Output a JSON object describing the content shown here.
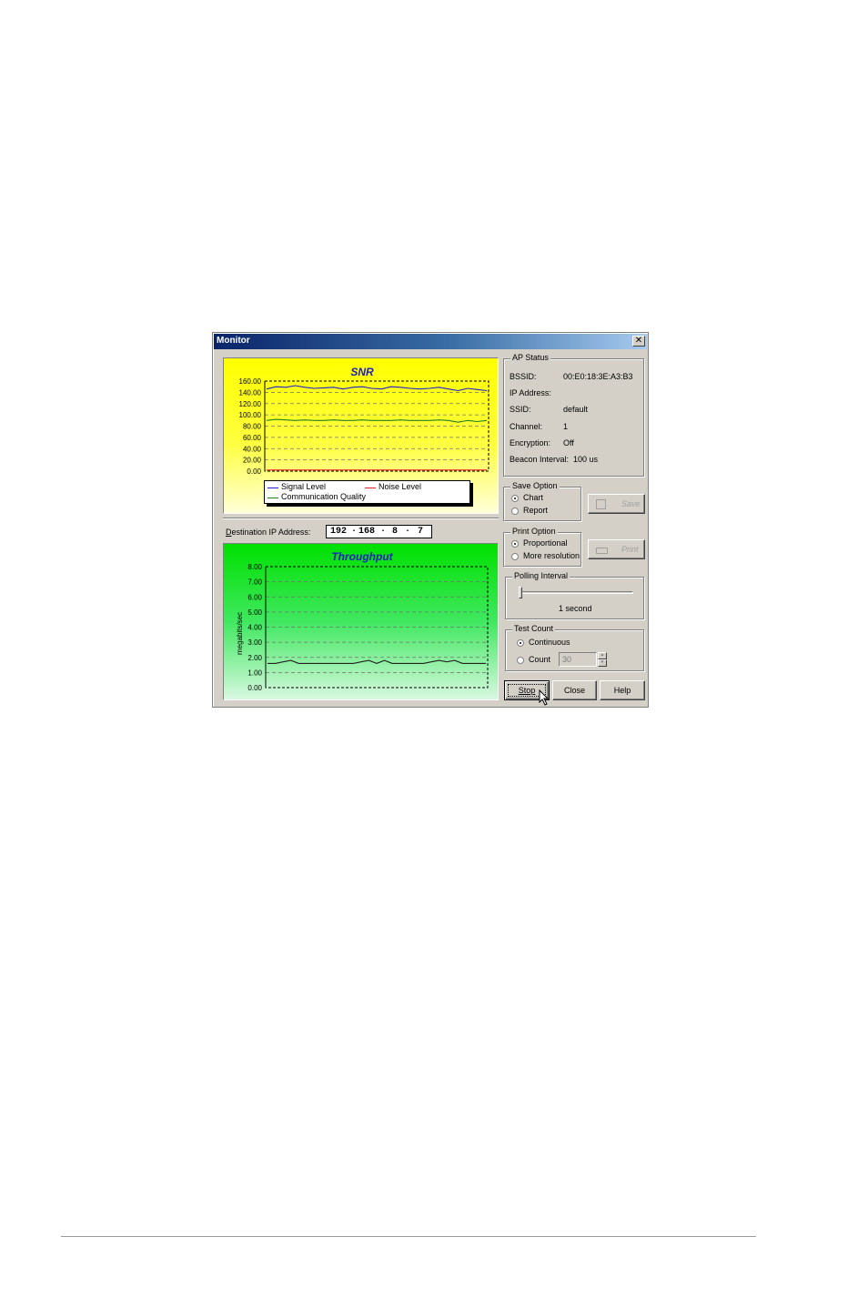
{
  "window": {
    "title": "Monitor",
    "close_glyph": "✕"
  },
  "snr": {
    "title": "SNR",
    "y_ticks": [
      "160.00",
      "140.00",
      "120.00",
      "100.00",
      "80.00",
      "60.00",
      "40.00",
      "20.00",
      "0.00"
    ],
    "legend": {
      "signal": "Signal Level",
      "noise": "Noise Level",
      "quality": "Communication Quality"
    },
    "colors": {
      "signal": "#2020d0",
      "noise": "#e02020",
      "quality": "#208020",
      "bg_top": "#ffff00"
    }
  },
  "chart_data": [
    {
      "type": "line",
      "title": "SNR",
      "ylim": [
        0,
        160
      ],
      "series": [
        {
          "name": "Signal Level",
          "values": [
            146,
            150,
            149,
            152,
            149,
            147,
            148,
            149,
            146,
            149,
            150,
            147,
            146,
            150,
            149,
            147,
            146,
            147,
            149,
            146,
            143,
            147,
            145,
            143
          ]
        },
        {
          "name": "Noise Level",
          "values": [
            2,
            2,
            2,
            2,
            2,
            2,
            2,
            2,
            2,
            2,
            2,
            2,
            2,
            2,
            2,
            2,
            2,
            2,
            2,
            2,
            2,
            2,
            2,
            2
          ]
        },
        {
          "name": "Communication Quality",
          "values": [
            90,
            92,
            91,
            90,
            91,
            90,
            90,
            91,
            90,
            90,
            91,
            90,
            90,
            90,
            91,
            90,
            90,
            90,
            91,
            90,
            87,
            90,
            88,
            90
          ]
        }
      ]
    },
    {
      "type": "line",
      "title": "Throughput",
      "ylabel": "megabits/sec",
      "ylim": [
        0,
        8
      ],
      "series": [
        {
          "name": "",
          "values": [
            1.6,
            1.6,
            1.7,
            1.8,
            1.6,
            1.6,
            1.6,
            1.6,
            1.6,
            1.6,
            1.6,
            1.6,
            1.7,
            1.8,
            1.6,
            1.8,
            1.6,
            1.6,
            1.6,
            1.6,
            1.6,
            1.7,
            1.8,
            1.7,
            1.8,
            1.6,
            1.6,
            1.6,
            1.6
          ]
        }
      ]
    }
  ],
  "throughput": {
    "title": "Throughput",
    "ylabel": "megabits/sec",
    "y_ticks": [
      "8.00",
      "7.00",
      "6.00",
      "5.00",
      "4.00",
      "3.00",
      "2.00",
      "1.00",
      "0.00"
    ],
    "colors": {
      "line": "#202020",
      "bg_top": "#00e000"
    }
  },
  "destination": {
    "label": "Destination IP Address:",
    "octets": [
      "192",
      "168",
      "8",
      "7"
    ]
  },
  "ap_status": {
    "label": "AP Status",
    "rows": [
      {
        "key": "BSSID:",
        "value": "00:E0:18:3E:A3:B3"
      },
      {
        "key": "IP Address:",
        "value": ""
      },
      {
        "key": "SSID:",
        "value": "default"
      },
      {
        "key": "Channel:",
        "value": "1"
      },
      {
        "key": "Encryption:",
        "value": "Off"
      },
      {
        "key": "Beacon Interval:",
        "value": "100 us"
      }
    ]
  },
  "save_option": {
    "label": "Save Option",
    "chart": "Chart",
    "report": "Report",
    "selected": "Chart",
    "save_button": "Save"
  },
  "print_option": {
    "label": "Print Option",
    "proportional": "Proportional",
    "more": "More resolution",
    "selected": "Proportional",
    "print_button": "Print"
  },
  "polling": {
    "label": "Polling Interval",
    "value_text": "1 second",
    "slider_fraction": 0
  },
  "test_count": {
    "label": "Test Count",
    "continuous": "Continuous",
    "count": "Count",
    "count_value": "30",
    "selected": "Continuous"
  },
  "buttons": {
    "stop": "Stop",
    "close": "Close",
    "help": "Help"
  }
}
